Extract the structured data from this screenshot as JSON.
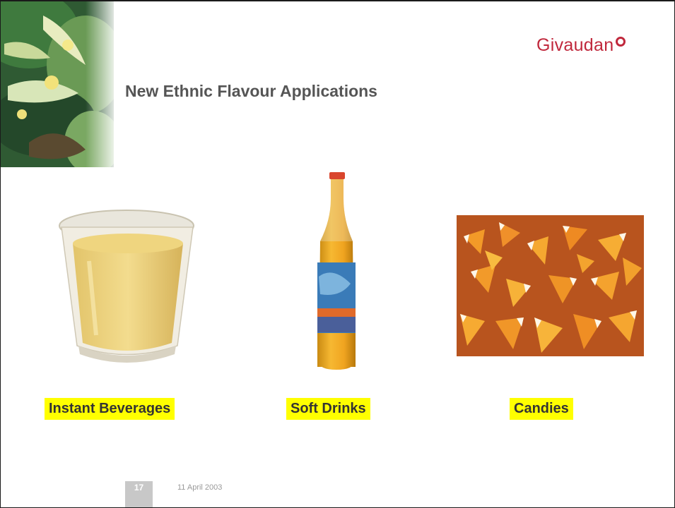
{
  "logo": {
    "text": "Givaudan"
  },
  "title": "New Ethnic Flavour Applications",
  "products": [
    {
      "label": "Instant Beverages",
      "image": "glass-of-beverage-photo"
    },
    {
      "label": "Soft Drinks",
      "image": "soft-drink-bottle-photo"
    },
    {
      "label": "Candies",
      "image": "candy-corn-photo"
    }
  ],
  "footer": {
    "page_number": "17",
    "date": "11 April 2003"
  },
  "colors": {
    "brand": "#c0283c",
    "caption_highlight": "#ffff00",
    "title": "#555555"
  }
}
